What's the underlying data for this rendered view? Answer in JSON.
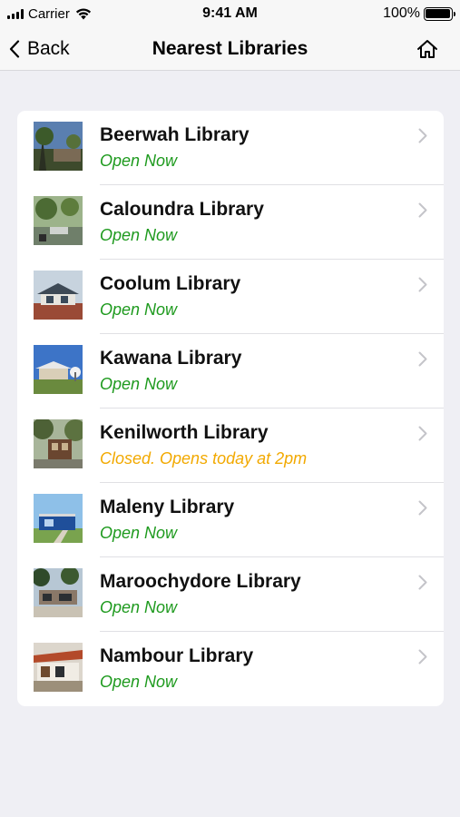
{
  "status_bar": {
    "carrier": "Carrier",
    "time": "9:41 AM",
    "battery_text": "100%",
    "battery_level": 1.0
  },
  "nav": {
    "back_label": "Back",
    "title": "Nearest Libraries",
    "home_icon": "home-icon"
  },
  "colors": {
    "open": "#1e9a1e",
    "closed": "#f2a900",
    "background": "#efeff4"
  },
  "libraries": [
    {
      "name": "Beerwah Library",
      "status": "Open Now",
      "state": "open",
      "thumb": "beerwah"
    },
    {
      "name": "Caloundra Library",
      "status": "Open Now",
      "state": "open",
      "thumb": "caloundra"
    },
    {
      "name": "Coolum Library",
      "status": "Open Now",
      "state": "open",
      "thumb": "coolum"
    },
    {
      "name": "Kawana Library",
      "status": "Open Now",
      "state": "open",
      "thumb": "kawana"
    },
    {
      "name": "Kenilworth Library",
      "status": "Closed. Opens today at 2pm",
      "state": "closed",
      "thumb": "kenilworth"
    },
    {
      "name": "Maleny Library",
      "status": "Open Now",
      "state": "open",
      "thumb": "maleny"
    },
    {
      "name": "Maroochydore Library",
      "status": "Open Now",
      "state": "open",
      "thumb": "maroochydore"
    },
    {
      "name": "Nambour Library",
      "status": "Open Now",
      "state": "open",
      "thumb": "nambour"
    }
  ]
}
